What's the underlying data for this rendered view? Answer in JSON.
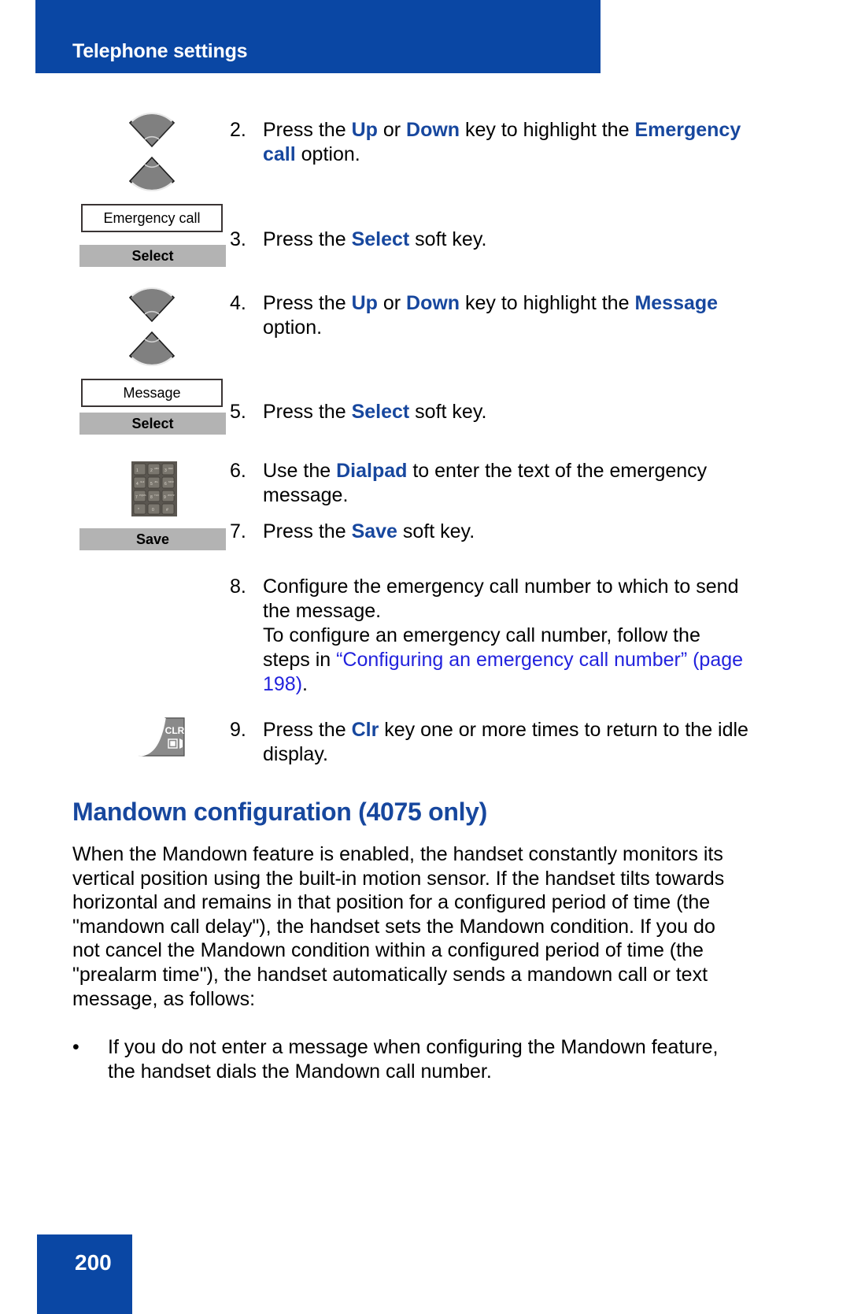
{
  "header": {
    "title": "Telephone settings",
    "bar_color": "#0A47A4"
  },
  "colors": {
    "brand_blue": "#0A47A4",
    "keyword_blue": "#17479E",
    "xref_blue": "#2222DD",
    "softkey_gray": "#b3b3b3",
    "key_gray": "#8a8a8a"
  },
  "steps": [
    {
      "num": "2.",
      "parts": [
        {
          "t": "Press the ",
          "s": "plain"
        },
        {
          "t": "Up",
          "s": "kw"
        },
        {
          "t": " or ",
          "s": "plain"
        },
        {
          "t": "Down",
          "s": "kw"
        },
        {
          "t": " key to highlight the ",
          "s": "plain"
        },
        {
          "t": "Emergency call",
          "s": "kw"
        },
        {
          "t": " option.",
          "s": "plain"
        }
      ],
      "text": "Press the Up or Down key to highlight the Emergency call option."
    },
    {
      "num": "3.",
      "parts": [
        {
          "t": "Press the ",
          "s": "plain"
        },
        {
          "t": "Select",
          "s": "kw"
        },
        {
          "t": " soft key.",
          "s": "plain"
        }
      ],
      "text": "Press the Select soft key."
    },
    {
      "num": "4.",
      "parts": [
        {
          "t": "Press the ",
          "s": "plain"
        },
        {
          "t": "Up",
          "s": "kw"
        },
        {
          "t": " or ",
          "s": "plain"
        },
        {
          "t": "Down",
          "s": "kw"
        },
        {
          "t": " key to highlight the ",
          "s": "plain"
        },
        {
          "t": "Message",
          "s": "kw"
        },
        {
          "t": " option.",
          "s": "plain"
        }
      ],
      "text": "Press the Up or Down key to highlight the Message option."
    },
    {
      "num": "5.",
      "parts": [
        {
          "t": "Press the ",
          "s": "plain"
        },
        {
          "t": "Select",
          "s": "kw"
        },
        {
          "t": " soft key.",
          "s": "plain"
        }
      ],
      "text": "Press the Select soft key."
    },
    {
      "num": "6.",
      "parts": [
        {
          "t": "Use the ",
          "s": "plain"
        },
        {
          "t": "Dialpad",
          "s": "kw"
        },
        {
          "t": " to enter the text of the emergency message.",
          "s": "plain"
        }
      ],
      "text": "Use the Dialpad to enter the text of the emergency message."
    },
    {
      "num": "7.",
      "parts": [
        {
          "t": "Press the ",
          "s": "plain"
        },
        {
          "t": "Save",
          "s": "kw"
        },
        {
          "t": " soft key.",
          "s": "plain"
        }
      ],
      "text": "Press the Save soft key."
    },
    {
      "num": "8.",
      "parts": [
        {
          "t": "Configure the emergency call number to which to send the message.",
          "s": "plain"
        },
        {
          "t": "\n",
          "s": "br"
        },
        {
          "t": "To configure an emergency call number, follow the steps in ",
          "s": "plain"
        },
        {
          "t": "“Configuring an emergency call number” (page 198)",
          "s": "xref"
        },
        {
          "t": ".",
          "s": "plain"
        }
      ],
      "text": "Configure the emergency call number to which to send the message. To configure an emergency call number, follow the steps in “Configuring an emergency call number” (page 198)."
    },
    {
      "num": "9.",
      "parts": [
        {
          "t": "Press the ",
          "s": "plain"
        },
        {
          "t": "Clr",
          "s": "kw"
        },
        {
          "t": " key one or more times to return to the idle display.",
          "s": "plain"
        }
      ],
      "text": "Press the Clr key one or more times to return to the idle display."
    }
  ],
  "figures": {
    "display_emergency_call": "Emergency call",
    "softkey_select_1": "Select",
    "display_message": "Message",
    "softkey_select_2": "Select",
    "softkey_save": "Save",
    "clr_key_label": "CLR",
    "navkey_up_name": "nav-up-key",
    "navkey_down_name": "nav-down-key",
    "dialpad_keys": [
      {
        "digit": "1",
        "letters": ""
      },
      {
        "digit": "2",
        "letters": "ABC"
      },
      {
        "digit": "3",
        "letters": "DEF"
      },
      {
        "digit": "4",
        "letters": "GHI"
      },
      {
        "digit": "5",
        "letters": "JKL"
      },
      {
        "digit": "6",
        "letters": "MNO"
      },
      {
        "digit": "7",
        "letters": "PQRS"
      },
      {
        "digit": "8",
        "letters": "TUV"
      },
      {
        "digit": "9",
        "letters": "WXYZ"
      },
      {
        "digit": "*",
        "letters": ""
      },
      {
        "digit": "0",
        "letters": ""
      },
      {
        "digit": "#",
        "letters": ""
      }
    ]
  },
  "section": {
    "heading": "Mandown configuration (4075 only)",
    "paragraph": "When the Mandown feature is enabled, the handset constantly monitors its vertical position using the built-in motion sensor. If the handset tilts towards horizontal and remains in that position for a configured period of time (the \"mandown call delay\"), the handset sets the Mandown condition. If you do not cancel the Mandown condition within a configured period of time (the \"prealarm time\"), the handset automatically sends a mandown call or text message, as follows:",
    "bullets": [
      {
        "mark": "•",
        "text": "If you do not enter a message when configuring the Mandown feature, the handset dials the Mandown call number."
      }
    ]
  },
  "footer": {
    "page_number": "200"
  }
}
